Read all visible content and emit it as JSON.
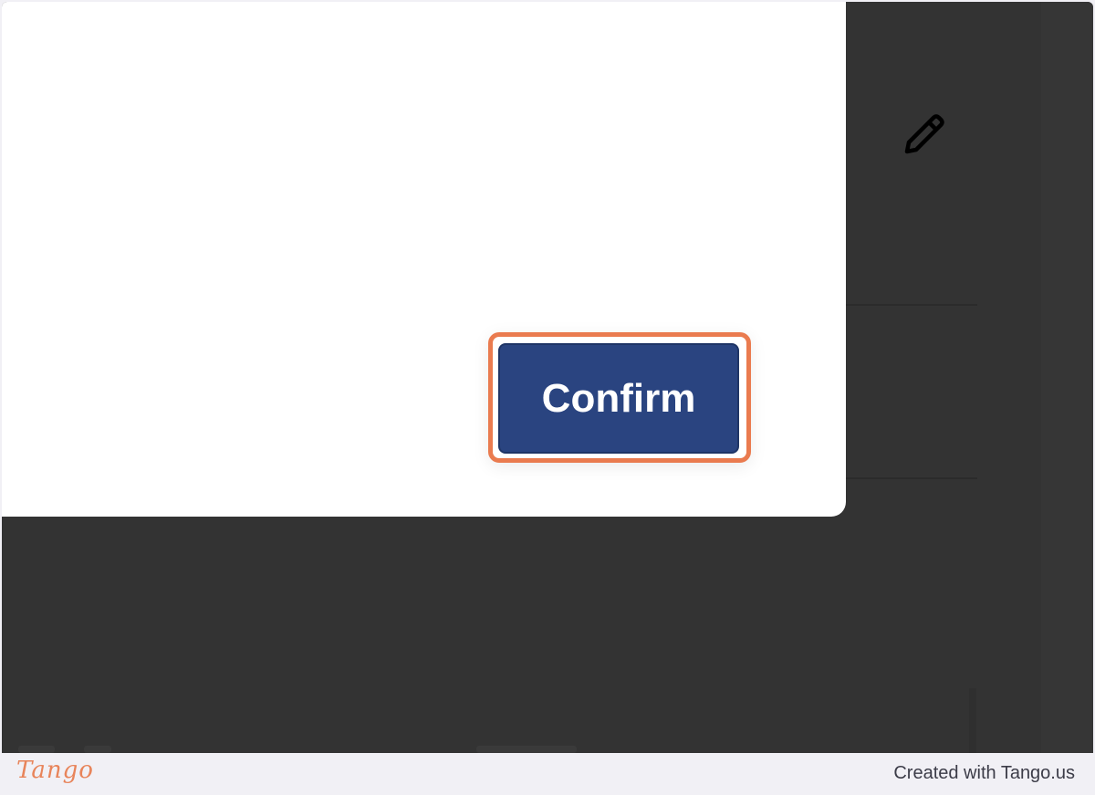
{
  "modal": {
    "confirm_label": "Confirm"
  },
  "background": {
    "edit_icon": "pencil-icon"
  },
  "footer": {
    "logo_text": "Tango",
    "credit_text": "Created with Tango.us"
  },
  "colors": {
    "overlay": "#333333",
    "modal": "#ffffff",
    "confirm_button": "#2a4480",
    "highlight": "#ea7b4f",
    "footer_bg": "#f1f0f5",
    "logo": "#e8845a"
  }
}
